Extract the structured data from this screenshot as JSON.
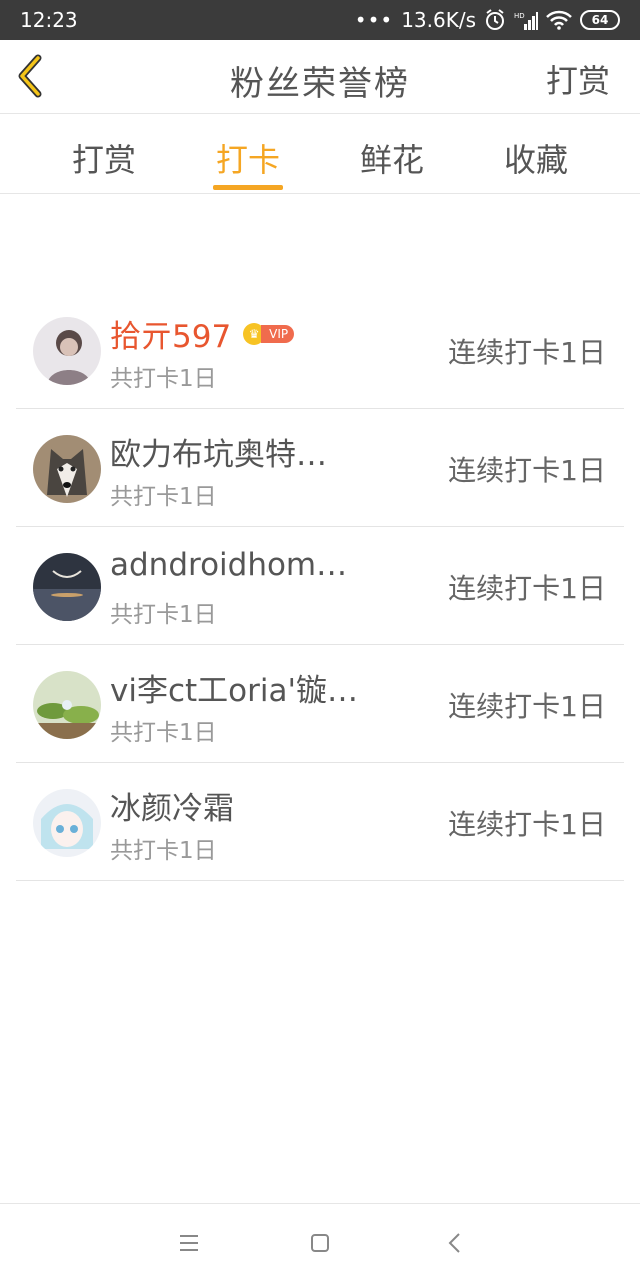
{
  "status_bar": {
    "time": "12:23",
    "network_speed": "13.6K/s",
    "battery": "64",
    "icons": [
      "dots-icon",
      "alarm-icon",
      "signal-icon",
      "wifi-icon",
      "battery-icon"
    ]
  },
  "header": {
    "title": "粉丝荣誉榜",
    "action_label": "打赏",
    "back_icon": "chevron-left-icon"
  },
  "tabs": [
    {
      "label": "打赏",
      "active": false
    },
    {
      "label": "打卡",
      "active": true
    },
    {
      "label": "鲜花",
      "active": false
    },
    {
      "label": "收藏",
      "active": false
    }
  ],
  "accent_color": "#f5a623",
  "vip_name_color": "#e8562f",
  "list": [
    {
      "name": "拾亓597",
      "vip": true,
      "vip_label": "VIP",
      "total": "共打卡1日",
      "streak": "连续打卡1日",
      "avatar": "person-photo"
    },
    {
      "name": "欧力布坑奥特…",
      "vip": false,
      "total": "共打卡1日",
      "streak": "连续打卡1日",
      "avatar": "husky-photo"
    },
    {
      "name": "adndroidhom…",
      "vip": false,
      "total": "共打卡1日",
      "streak": "连续打卡1日",
      "avatar": "night-sky-photo"
    },
    {
      "name": "vi李ct工oria'镟…",
      "vip": false,
      "total": "共打卡1日",
      "streak": "连续打卡1日",
      "avatar": "plant-photo"
    },
    {
      "name": "冰颜冷霜",
      "vip": false,
      "total": "共打卡1日",
      "streak": "连续打卡1日",
      "avatar": "anime-girl-photo"
    }
  ],
  "nav_bar": {
    "buttons": [
      "menu-icon",
      "home-icon",
      "back-icon"
    ]
  }
}
